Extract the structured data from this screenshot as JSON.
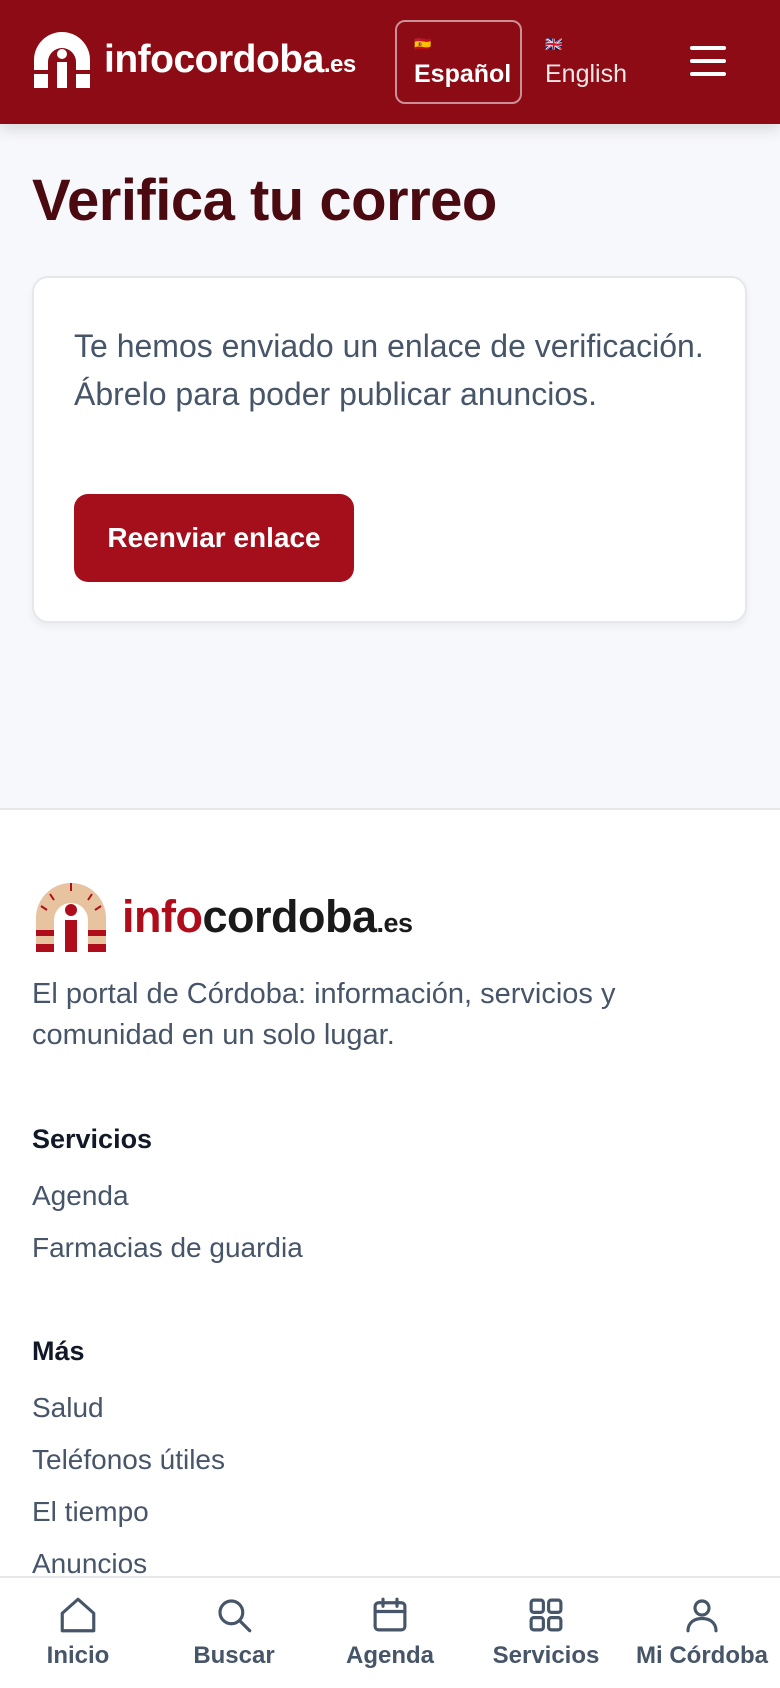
{
  "header": {
    "logo": {
      "name": "infocordoba",
      "tld": ".es"
    },
    "languages": [
      {
        "flag": "🇪🇸",
        "label": "Español",
        "active": true
      },
      {
        "flag": "🇬🇧",
        "label": "English",
        "active": false
      }
    ],
    "menu_icon": "hamburger-menu-icon"
  },
  "main": {
    "title": "Verifica tu correo",
    "message": "Te hemos enviado un enlace de verificación. Ábrelo para poder publicar anuncios.",
    "resend_label": "Reenviar enlace"
  },
  "footer": {
    "logo": {
      "info": "info",
      "cordoba": "cordoba",
      "tld": ".es"
    },
    "tagline": "El portal de Córdoba: información, servicios y comunidad en un solo lugar.",
    "sections": [
      {
        "title": "Servicios",
        "links": [
          "Agenda",
          "Farmacias de guardia"
        ]
      },
      {
        "title": "Más",
        "links": [
          "Salud",
          "Teléfonos útiles",
          "El tiempo",
          "Anuncios"
        ]
      }
    ]
  },
  "bottom_nav": [
    {
      "label": "Inicio",
      "icon": "home-icon"
    },
    {
      "label": "Buscar",
      "icon": "search-icon"
    },
    {
      "label": "Agenda",
      "icon": "calendar-icon"
    },
    {
      "label": "Servicios",
      "icon": "grid-icon"
    },
    {
      "label": "Mi Córdoba",
      "icon": "user-icon"
    }
  ],
  "colors": {
    "brand": "#8c0b14",
    "button": "#a50e1b",
    "title": "#4a0a10"
  }
}
